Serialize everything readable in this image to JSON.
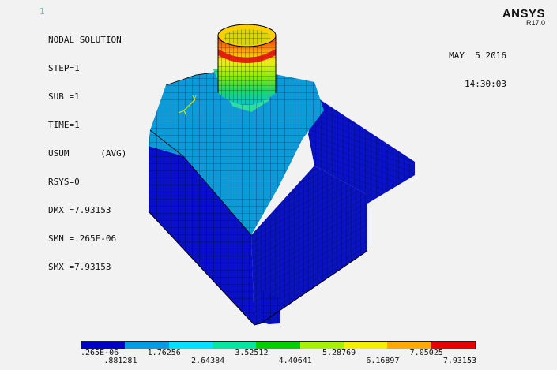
{
  "window_number": "1",
  "info": {
    "title": "NODAL SOLUTION",
    "step": "STEP=1",
    "sub": "SUB =1",
    "time": "TIME=1",
    "usum": "USUM      (AVG)",
    "rsys": "RSYS=0",
    "dmx": "DMX =7.93153",
    "smn": "SMN =.265E-06",
    "smx": "SMX =7.93153"
  },
  "brand": {
    "name": "ANSYS",
    "version": "R17.0"
  },
  "date": "MAY  5 2016",
  "time_of_day": "14:30:03",
  "axis_label": "Y",
  "legend": {
    "colors": [
      "#0000c8",
      "#009ee0",
      "#00e0ff",
      "#00e8a0",
      "#00d000",
      "#a8f000",
      "#f0f000",
      "#ffaa00",
      "#e80000"
    ],
    "labels": [
      ".265E-06",
      ".881281",
      "1.76256",
      "2.64384",
      "3.52512",
      "4.40641",
      "5.28769",
      "6.16897",
      "7.05025",
      "7.93153"
    ]
  }
}
